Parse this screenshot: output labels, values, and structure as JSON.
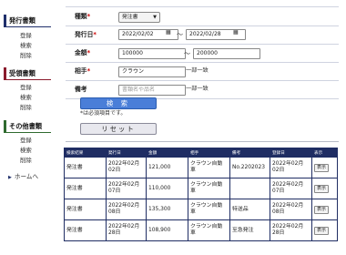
{
  "sidebar": {
    "sections": [
      {
        "title": "発行書類",
        "items": [
          "登録",
          "検索",
          "削除"
        ]
      },
      {
        "title": "受領書類",
        "items": [
          "登録",
          "検索",
          "削除"
        ]
      },
      {
        "title": "その他書類",
        "items": [
          "登録",
          "検索",
          "削除"
        ]
      }
    ],
    "home": "ホームへ"
  },
  "form": {
    "type": {
      "label": "種類",
      "req": "*",
      "value": "発注書"
    },
    "date": {
      "label": "発行日",
      "req": "*",
      "from": "2022/02/02",
      "to": "2022/02/28",
      "sep": "〜"
    },
    "amount": {
      "label": "金額",
      "req": "*",
      "from": "100000",
      "to": "200000",
      "sep": "〜"
    },
    "partner": {
      "label": "相手",
      "req": "*",
      "value": "クラウン",
      "match": "一部一致"
    },
    "remarks": {
      "label": "備考",
      "placeholder": "書類名や品名",
      "match": "一部一致"
    },
    "search_label": "検 索",
    "note": "*は必須項目です。",
    "reset_label": "リセット"
  },
  "table": {
    "headers": [
      "検索結果",
      "発行日",
      "金額",
      "相手",
      "備考",
      "登録日",
      "表示"
    ],
    "rows": [
      {
        "type": "発注書",
        "date": "2022年02月02日",
        "amount": "121,000",
        "partner": "クラウン自動車",
        "remarks": "No.2202023",
        "registered": "2022年02月02日",
        "action": "表示"
      },
      {
        "type": "発注書",
        "date": "2022年02月07日",
        "amount": "110,000",
        "partner": "クラウン自動車",
        "remarks": "",
        "registered": "2022年02月07日",
        "action": "表示"
      },
      {
        "type": "発注書",
        "date": "2022年02月08日",
        "amount": "135,300",
        "partner": "クラウン自動車",
        "remarks": "特送品",
        "registered": "2022年02月08日",
        "action": "表示"
      },
      {
        "type": "発注書",
        "date": "2022年02月28日",
        "amount": "108,900",
        "partner": "クラウン自動車",
        "remarks": "至急発注",
        "registered": "2022年02月28日",
        "action": "表示"
      }
    ]
  },
  "colors": {
    "navy": "#1f2d63",
    "button_blue": "#4a7ed8",
    "required": "#cc0000"
  }
}
